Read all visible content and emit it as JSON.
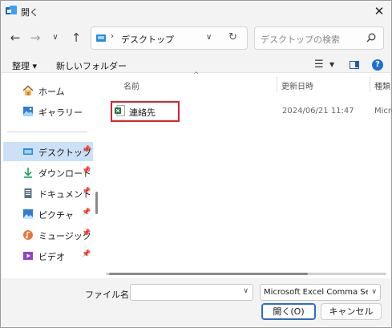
{
  "window": {
    "title": "開く",
    "close_glyph": "✕"
  },
  "nav": {
    "back_glyph": "←",
    "forward_glyph": "→",
    "recent_glyph": "∨",
    "up_glyph": "↑",
    "address_separator": "›",
    "address_text": "デスクトップ",
    "address_dropdown_glyph": "∨",
    "refresh_glyph": "↻",
    "search_placeholder": "デスクトップの検索"
  },
  "toolbar": {
    "organize_label": "整理 ▾",
    "new_folder_label": "新しいフォルダー",
    "view_glyph": "☰",
    "view_dropdown_glyph": "▼",
    "help_glyph": "?"
  },
  "sidebar": {
    "items": [
      {
        "label": "ホーム",
        "icon": "home-icon",
        "pinned": false
      },
      {
        "label": "ギャラリー",
        "icon": "gallery-icon",
        "pinned": false
      },
      {
        "label": "デスクトップ",
        "icon": "desktop-icon",
        "pinned": true
      },
      {
        "label": "ダウンロード",
        "icon": "download-icon",
        "pinned": true
      },
      {
        "label": "ドキュメント",
        "icon": "document-icon",
        "pinned": true
      },
      {
        "label": "ピクチャ",
        "icon": "picture-icon",
        "pinned": true
      },
      {
        "label": "ミュージック",
        "icon": "music-icon",
        "pinned": true
      },
      {
        "label": "ビデオ",
        "icon": "video-icon",
        "pinned": true
      }
    ],
    "pin_glyph": "📌",
    "selected": "デスクトップ"
  },
  "file_list": {
    "sort_glyph": "^",
    "columns": [
      "名前",
      "更新日時",
      "種類"
    ],
    "rows": [
      {
        "name": "連絡先",
        "modified": "2024/06/21 11:47",
        "type": "Micro",
        "icon": "excel-csv-icon"
      }
    ]
  },
  "bottom": {
    "filename_label": "ファイル名(N):",
    "filename_value": "",
    "dropdown_glyph": "∨",
    "file_type": "Microsoft Excel Comma Separated Values File",
    "open_button": "開く(O)",
    "cancel_button": "キャンセル"
  },
  "colors": {
    "accent": "#2f6ad0",
    "selected_bg": "#cce0f7",
    "highlight_border": "#d7232e",
    "excel_green": "#1e7145"
  }
}
